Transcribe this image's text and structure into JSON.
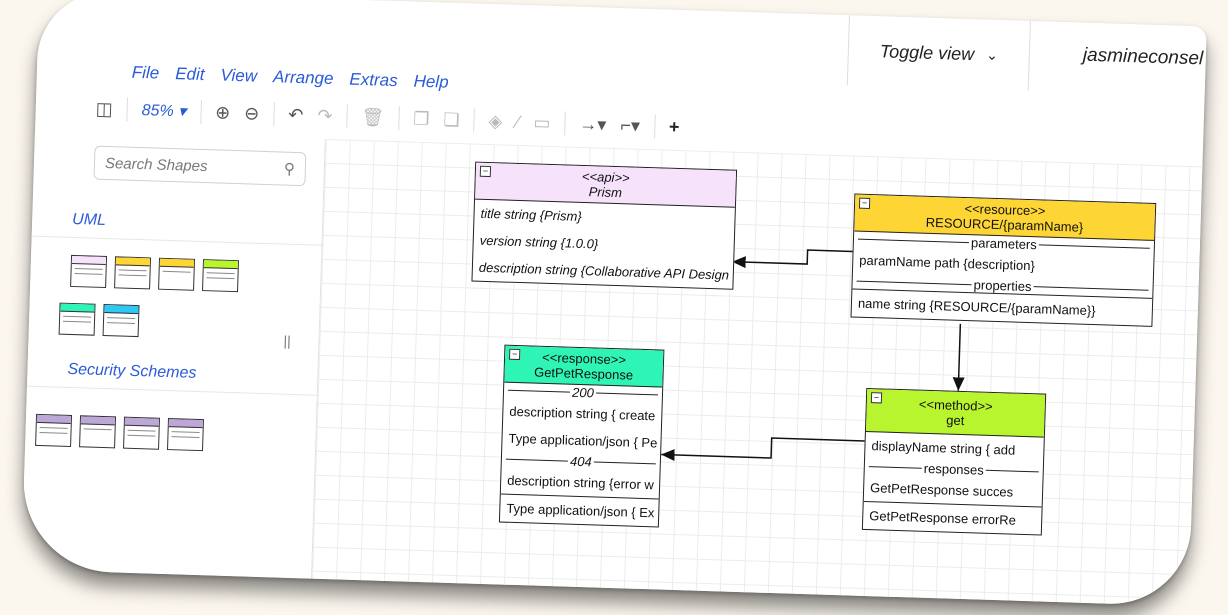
{
  "header": {
    "toggle_view": "Toggle view",
    "user": "jasmineconsel"
  },
  "menu": [
    "File",
    "Edit",
    "View",
    "Arrange",
    "Extras",
    "Help"
  ],
  "toolbar": {
    "zoom": "85%"
  },
  "sidebar": {
    "search_placeholder": "Search Shapes",
    "sections": [
      {
        "title": "UML"
      },
      {
        "title": "Security Schemes"
      }
    ],
    "divider_glyph": "||"
  },
  "diagram": {
    "api": {
      "stereotype": "<<api>>",
      "name": "Prism",
      "color": "#f6e3fb",
      "rows": [
        "title string {Prism}",
        "version string {1.0.0}",
        "description string {Collaborative API Design Platf"
      ]
    },
    "resource": {
      "stereotype": "<<resource>>",
      "name": "RESOURCE/{paramName}",
      "color": "#fdd535",
      "parameters_label": "parameters",
      "parameters": [
        "paramName path {description}"
      ],
      "properties_label": "properties",
      "properties": [
        "name string {RESOURCE/{paramName}}"
      ]
    },
    "response": {
      "stereotype": "<<response>>",
      "name": "GetPetResponse",
      "color": "#2ef5b5",
      "code_200": "200",
      "rows_200": [
        "description string { create",
        "Type application/json { Pe"
      ],
      "code_404": "404",
      "rows_404": [
        "description string {error w",
        "Type application/json { Ex"
      ]
    },
    "method": {
      "stereotype": "<<method>>",
      "name": "get",
      "color": "#b9f52e",
      "rows": [
        "displayName string { add"
      ],
      "responses_label": "responses",
      "responses": [
        "GetPetResponse succes",
        "GetPetResponse errorRe"
      ]
    }
  }
}
